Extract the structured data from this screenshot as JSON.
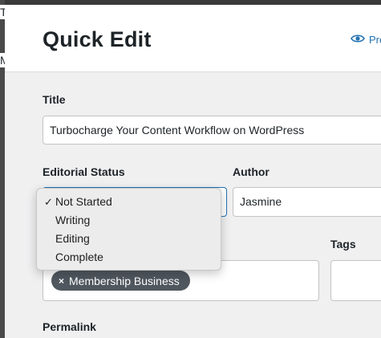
{
  "backdrop": {
    "letters": [
      "T",
      "M"
    ]
  },
  "modal": {
    "title": "Quick Edit",
    "preview_label": "Preview"
  },
  "fields": {
    "title": {
      "label": "Title",
      "value": "Turbocharge Your Content Workflow on WordPress"
    },
    "editorial_status": {
      "label": "Editorial Status",
      "selected": "Not Started",
      "options": [
        {
          "label": "Not Started",
          "checked": true
        },
        {
          "label": "Writing",
          "checked": false
        },
        {
          "label": "Editing",
          "checked": false
        },
        {
          "label": "Complete",
          "checked": false
        }
      ]
    },
    "author": {
      "label": "Author",
      "value": "Jasmine"
    },
    "categories": {
      "tokens": [
        {
          "remove_symbol": "×",
          "label": "Membership Business"
        }
      ]
    },
    "tags": {
      "label": "Tags",
      "value": ""
    },
    "permalink": {
      "label": "Permalink"
    }
  },
  "colors": {
    "accent": "#2271b1",
    "token_bg": "#50575e",
    "header_bg": "#ffffff",
    "body_bg": "#f0f0f1"
  },
  "icons": {
    "preview": "eye-icon",
    "check": "checkmark-icon"
  }
}
